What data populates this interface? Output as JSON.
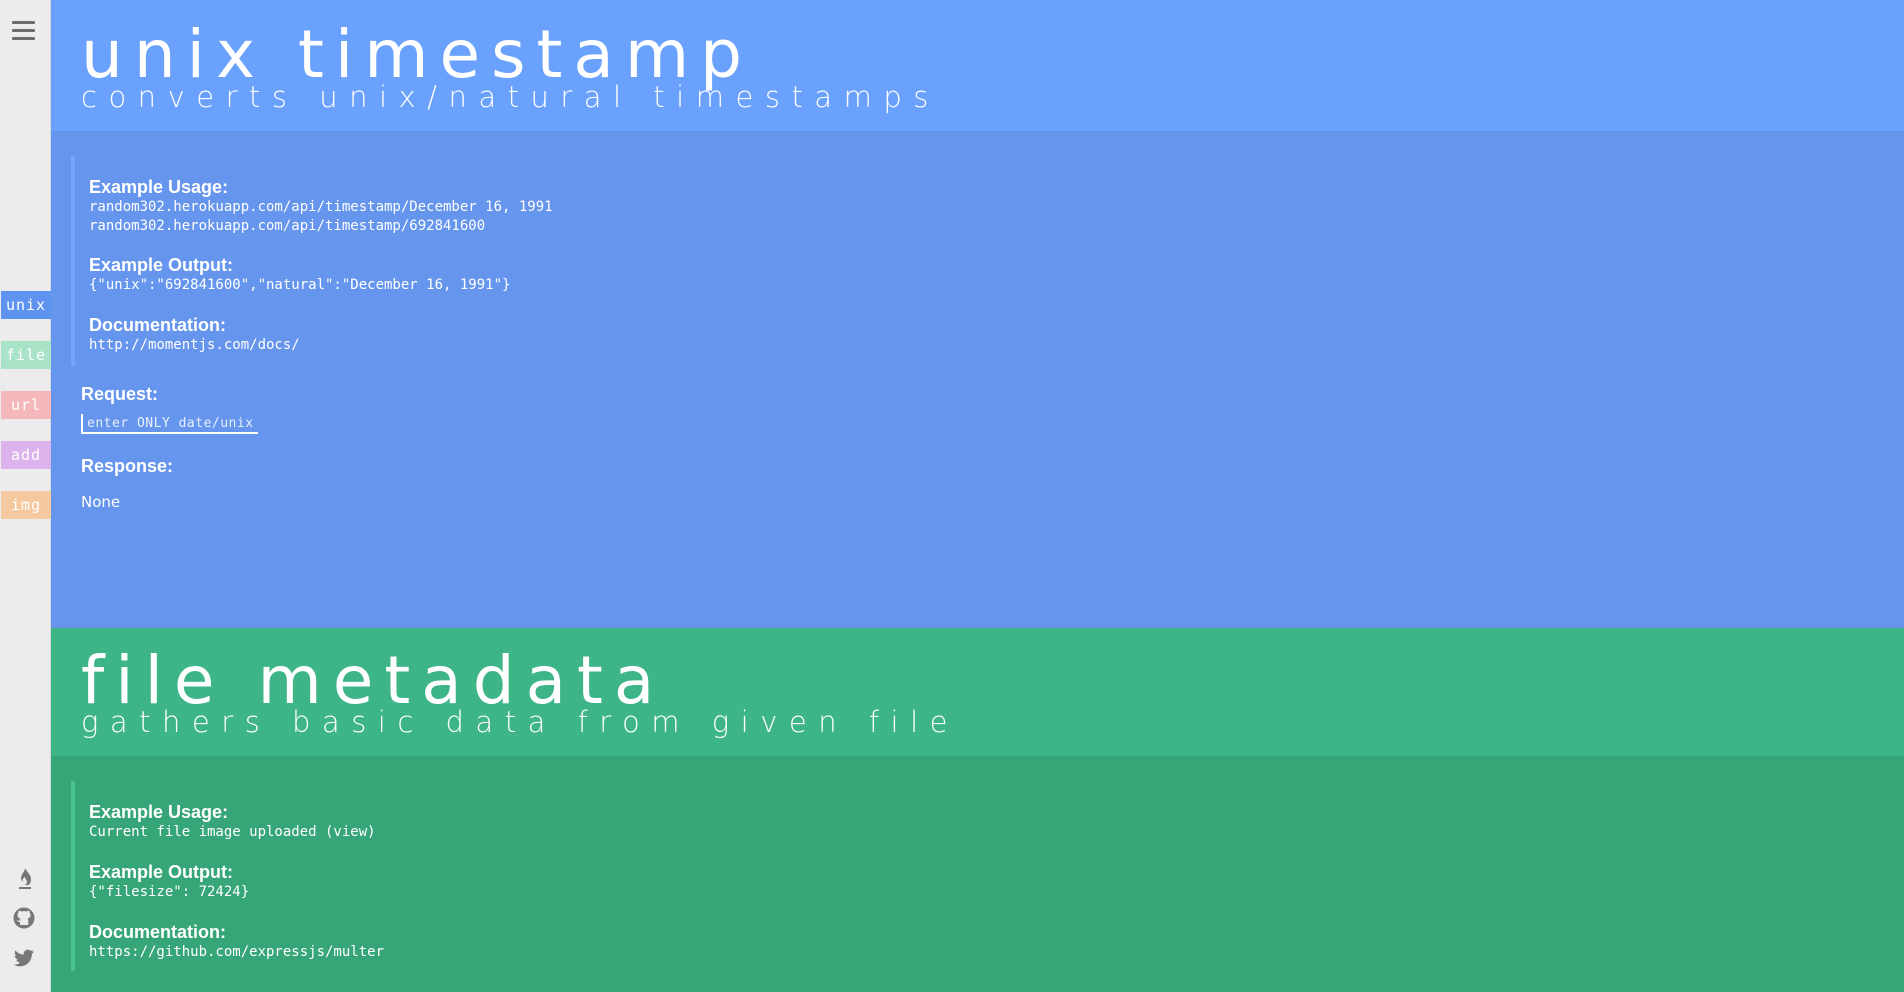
{
  "sidebar": {
    "menu_icon": "hamburger-menu-icon",
    "tabs": [
      {
        "label": "unix",
        "color": "#5f93f0",
        "text_color": "#ffffff"
      },
      {
        "label": "file",
        "color": "#a8e2c7",
        "text_color": "#ffffff"
      },
      {
        "label": "url",
        "color": "#f4b8ba",
        "text_color": "#ffffff"
      },
      {
        "label": "add",
        "color": "#dcb3ec",
        "text_color": "#ffffff"
      },
      {
        "label": "img",
        "color": "#f5c9a0",
        "text_color": "#ffffff"
      }
    ],
    "footer_icons": [
      "flame-icon",
      "github-icon",
      "twitter-icon"
    ]
  },
  "unix": {
    "header_color": "#6aa1fd",
    "body_color": "#6595ec",
    "accent": "#74a5ff",
    "title": "unix timestamp",
    "subtitle": "converts unix/natural timestamps",
    "example_usage_label": "Example Usage:",
    "example_usage_lines": [
      "random302.herokuapp.com/api/timestamp/December 16, 1991",
      "random302.herokuapp.com/api/timestamp/692841600"
    ],
    "example_output_label": "Example Output:",
    "example_output": "{\"unix\":\"692841600\",\"natural\":\"December 16, 1991\"}",
    "documentation_label": "Documentation:",
    "documentation": "http://momentjs.com/docs/",
    "request_label": "Request:",
    "request_placeholder": "enter ONLY date/unix",
    "request_value": "",
    "response_label": "Response:",
    "response_value": "None"
  },
  "file": {
    "header_color": "#3db587",
    "body_color": "#36a678",
    "accent": "#48c191",
    "title": "file metadata",
    "subtitle": "gathers basic data from given file",
    "example_usage_label": "Example Usage:",
    "example_usage_lines": [
      "Current file image uploaded (view)"
    ],
    "example_output_label": "Example Output:",
    "example_output": "{\"filesize\": 72424}",
    "documentation_label": "Documentation:",
    "documentation": "https://github.com/expressjs/multer"
  }
}
